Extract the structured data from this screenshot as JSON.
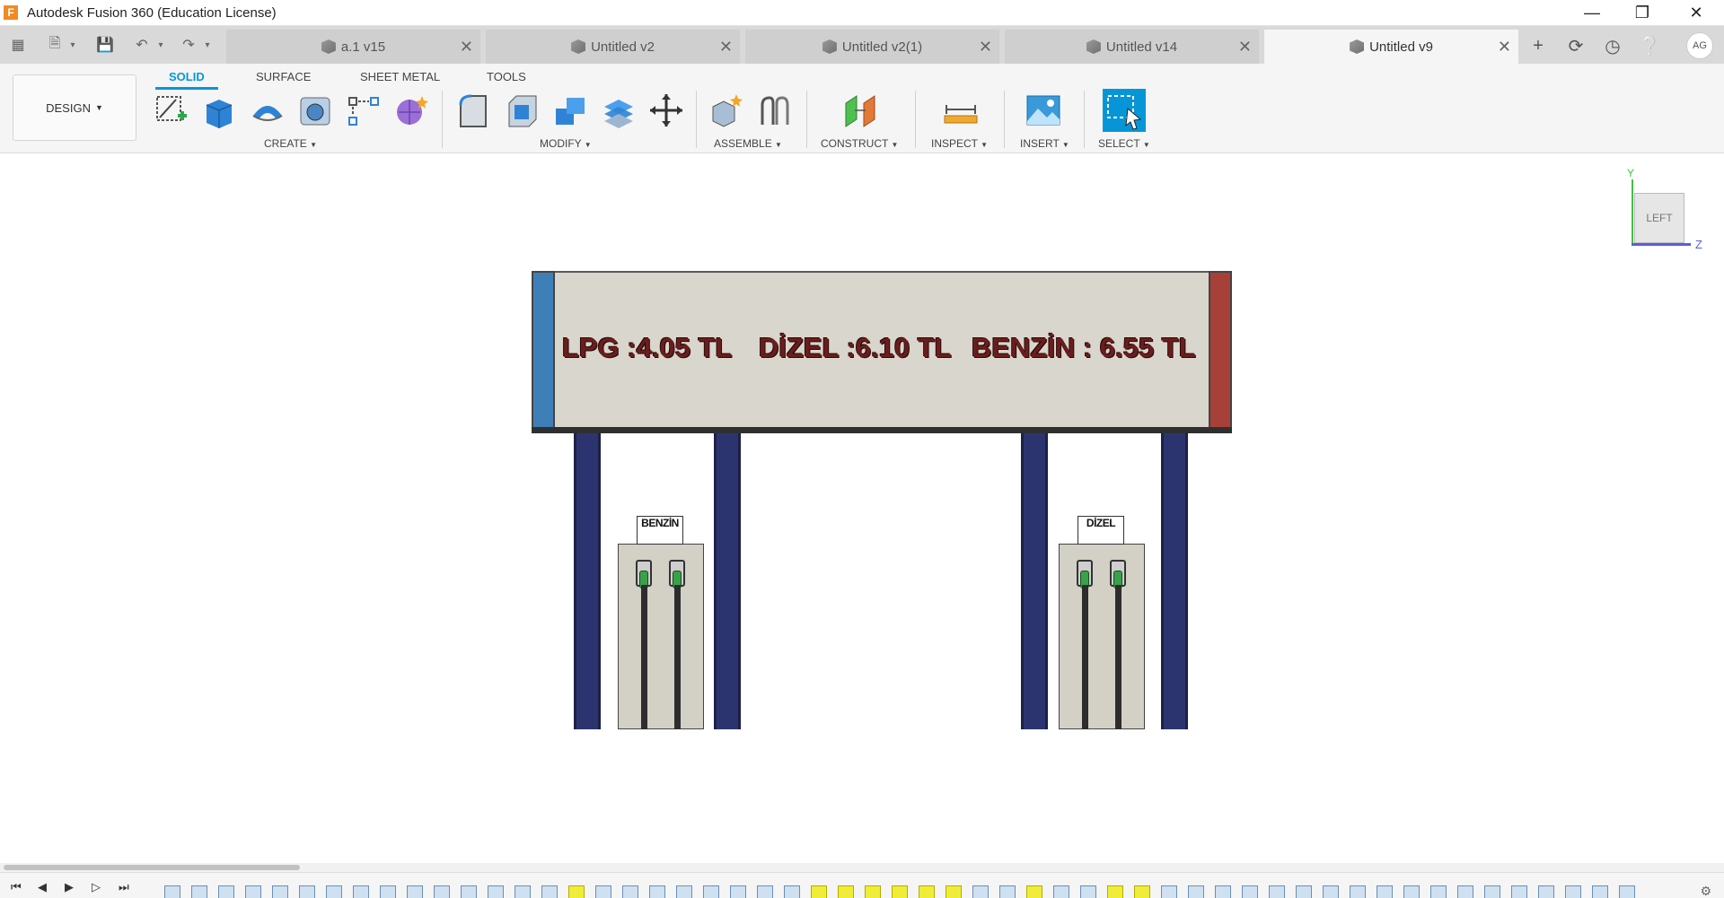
{
  "window": {
    "title": "Autodesk Fusion 360 (Education License)",
    "logo_letter": "F",
    "controls": [
      "minimize-icon",
      "restore-icon",
      "close-icon"
    ]
  },
  "tabs": [
    {
      "label": "a.1 v15",
      "active": false
    },
    {
      "label": "Untitled v2",
      "active": false
    },
    {
      "label": "Untitled v2(1)",
      "active": false
    },
    {
      "label": "Untitled v14",
      "active": false
    },
    {
      "label": "Untitled v9",
      "active": true
    }
  ],
  "user": {
    "initials": "AG"
  },
  "toolbar": {
    "workspace": "DESIGN",
    "workspace_tabs": [
      "SOLID",
      "SURFACE",
      "SHEET METAL",
      "TOOLS"
    ],
    "active_workspace_tab": "SOLID",
    "groups": [
      "CREATE",
      "MODIFY",
      "ASSEMBLE",
      "CONSTRUCT",
      "INSPECT",
      "INSERT",
      "SELECT"
    ]
  },
  "model": {
    "sign": {
      "prices": [
        {
          "text": "LPG :4.05 TL"
        },
        {
          "text": "DİZEL :6.10 TL"
        },
        {
          "text": "BENZİN : 6.55 TL"
        }
      ],
      "left_cap_color": "#3f7fb8",
      "right_cap_color": "#a8403a"
    },
    "pumps": [
      {
        "label": "BENZİN"
      },
      {
        "label": "DİZEL"
      }
    ]
  },
  "viewcube": {
    "face": "LEFT",
    "axis_y": "Y",
    "axis_z": "Z"
  },
  "accent_color": "#0696d7"
}
